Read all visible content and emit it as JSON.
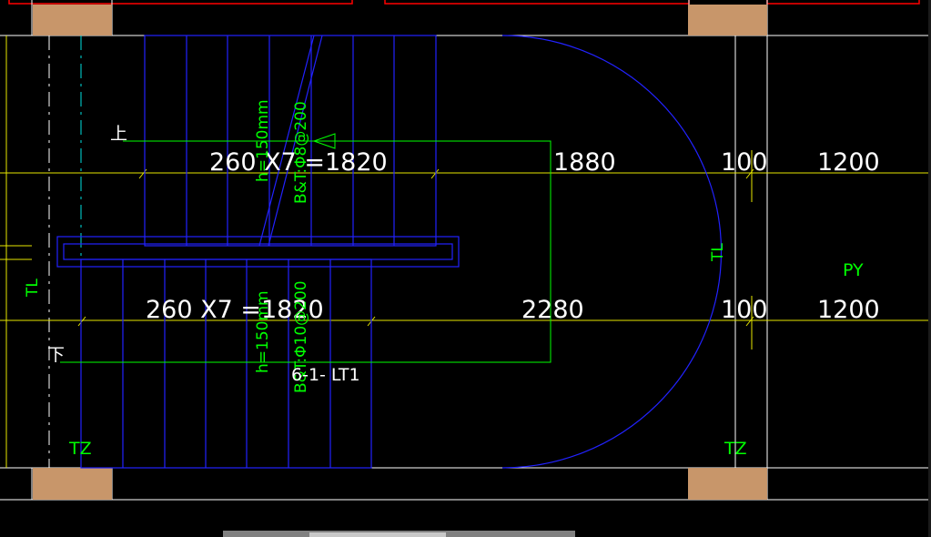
{
  "drawing": {
    "flight_upper": {
      "tread_dimension": "260 X7 =1820",
      "slab_height": "h=150mm",
      "reinforcement": "B&T:Φ8@200",
      "direction_mark": "上"
    },
    "flight_lower": {
      "tread_dimension": "260 X7 =1820",
      "slab_height": "h=150mm",
      "reinforcement": "B&T:Φ10@200",
      "direction_mark": "下"
    },
    "landing_dims": {
      "upper": "1880",
      "lower": "2280",
      "wall_gap_upper": "100",
      "wall_gap_lower": "100",
      "bay_upper": "1200",
      "bay_lower": "1200"
    },
    "labels": {
      "beam_left": "TL",
      "beam_right": "TL",
      "column_left": "TZ",
      "column_right": "TZ",
      "platform": "PY",
      "stair_id": "6-1- LT1"
    },
    "colors": {
      "background": "#000000",
      "stair_lines": "#2222ff",
      "annotation_green": "#00ff00",
      "axis_yellow": "#e6e600",
      "wall_white": "#ffffff",
      "column_fill": "#c8966a",
      "frame_red": "#ff0000",
      "axis_cyan": "#00e0e0"
    }
  }
}
